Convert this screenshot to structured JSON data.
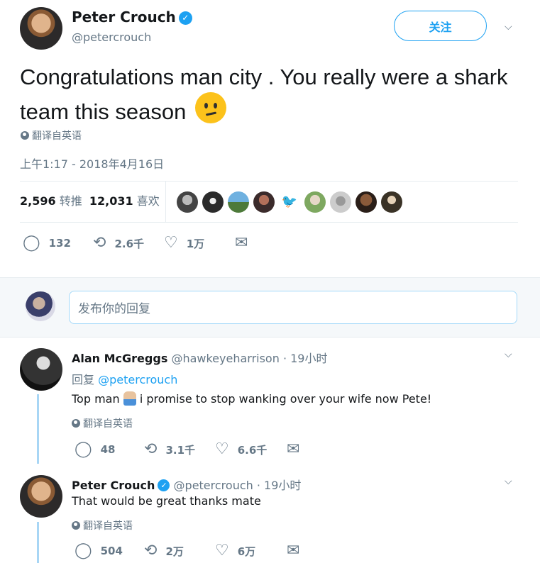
{
  "tweet": {
    "author_name": "Peter Crouch",
    "author_handle": "@petercrouch",
    "follow_label": "关注",
    "text": "Congratulations man city . You really were a shark team this season",
    "translate_label": "翻译自英语",
    "timestamp": "上午1:17 - 2018年4月16日",
    "retweets_count": "2,596",
    "retweets_label": "转推",
    "likes_count": "12,031",
    "likes_label": "喜欢",
    "actions": {
      "replies": "132",
      "retweets": "2.6千",
      "likes": "1万"
    }
  },
  "reply_box": {
    "placeholder": "发布你的回复"
  },
  "replies": [
    {
      "name": "Alan McGreggs",
      "handle": "@hawkeyeharrison · 19小时",
      "reply_to_prefix": "回复",
      "reply_to_handle": "@petercrouch",
      "text_before": "Top man",
      "text_after": "i promise to stop wanking over your wife now Pete!",
      "translate_label": "翻译自英语",
      "actions": {
        "replies": "48",
        "retweets": "3.1千",
        "likes": "6.6千"
      }
    },
    {
      "name": "Peter Crouch",
      "handle": "@petercrouch · 19小时",
      "text": "That would be great thanks mate",
      "translate_label": "翻译自英语",
      "actions": {
        "replies": "504",
        "retweets": "2万",
        "likes": "6万"
      }
    }
  ],
  "colors": {
    "accent": "#1da1f2",
    "muted": "#657786",
    "text": "#14171a"
  }
}
